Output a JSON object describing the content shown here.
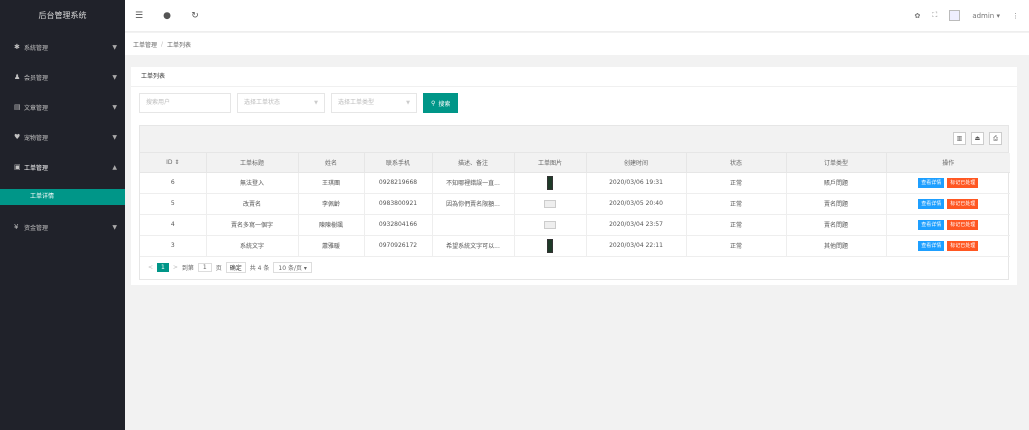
{
  "app_title": "后台管理系统",
  "sidebar": {
    "items": [
      {
        "label": "系統管理",
        "icon": "gear-icon",
        "glyph": "✱"
      },
      {
        "label": "会员管理",
        "icon": "users-icon",
        "glyph": "♟"
      },
      {
        "label": "文章管理",
        "icon": "document-icon",
        "glyph": "▤"
      },
      {
        "label": "宠物管理",
        "icon": "heart-icon",
        "glyph": "♥"
      },
      {
        "label": "工单管理",
        "icon": "ticket-icon",
        "glyph": "▣"
      },
      {
        "label": "资金管理",
        "icon": "yen-icon",
        "glyph": "¥"
      }
    ],
    "sub_item": "工单详情"
  },
  "topbar": {
    "menu_glyph": "☰",
    "chat_glyph": "●",
    "refresh_glyph": "↻",
    "theme_glyph": "✿",
    "fullscreen_glyph": "⛶",
    "user": "admin",
    "more_glyph": "⋮"
  },
  "breadcrumb": {
    "parent": "工单管理",
    "sep": "/",
    "current": "工单列表"
  },
  "card": {
    "title": "工单列表"
  },
  "filters": {
    "user_placeholder": "搜索用户",
    "status_placeholder": "选择工单状态",
    "type_placeholder": "选择工单类型",
    "search_label": "搜索"
  },
  "table": {
    "columns": [
      "ID ⇕",
      "工单标题",
      "姓名",
      "联系手机",
      "描述、备注",
      "工单图片",
      "创建时间",
      "状态",
      "订单类型",
      "操作"
    ],
    "rows": [
      {
        "id": "6",
        "title": "無法登入",
        "name": "王琪團",
        "phone": "0928219668",
        "desc": "不知哪裡錯誤一直...",
        "img": "dark",
        "created": "2020/03/06 19:31",
        "status": "正常",
        "type": "賬戶問題"
      },
      {
        "id": "5",
        "title": "改賣名",
        "name": "李佩齡",
        "phone": "0983800921",
        "desc": "因為你們賣名限額...",
        "img": "placeholder",
        "created": "2020/03/05 20:40",
        "status": "正常",
        "type": "賣名問題"
      },
      {
        "id": "4",
        "title": "賣名多寫一個字",
        "name": "陳陳樹颯",
        "phone": "0932804166",
        "desc": "",
        "img": "placeholder",
        "created": "2020/03/04 23:57",
        "status": "正常",
        "type": "賣名問題"
      },
      {
        "id": "3",
        "title": "系統文字",
        "name": "蕭雅暖",
        "phone": "0970926172",
        "desc": "希望系統文字可以...",
        "img": "dark",
        "created": "2020/03/04 22:11",
        "status": "正常",
        "type": "其他問題"
      }
    ],
    "action_view": "查看详情",
    "action_done": "标记已处理"
  },
  "pager": {
    "prev": "<",
    "page": "1",
    "next": ">",
    "goto_label": "到第",
    "goto_value": "1",
    "page_unit": "页",
    "confirm": "确定",
    "total": "共 4 条",
    "per_page": "10 条/页"
  },
  "colors": {
    "accent": "#009688",
    "sidebar": "#20222a",
    "blue": "#1e9fff",
    "red": "#ff5722"
  }
}
